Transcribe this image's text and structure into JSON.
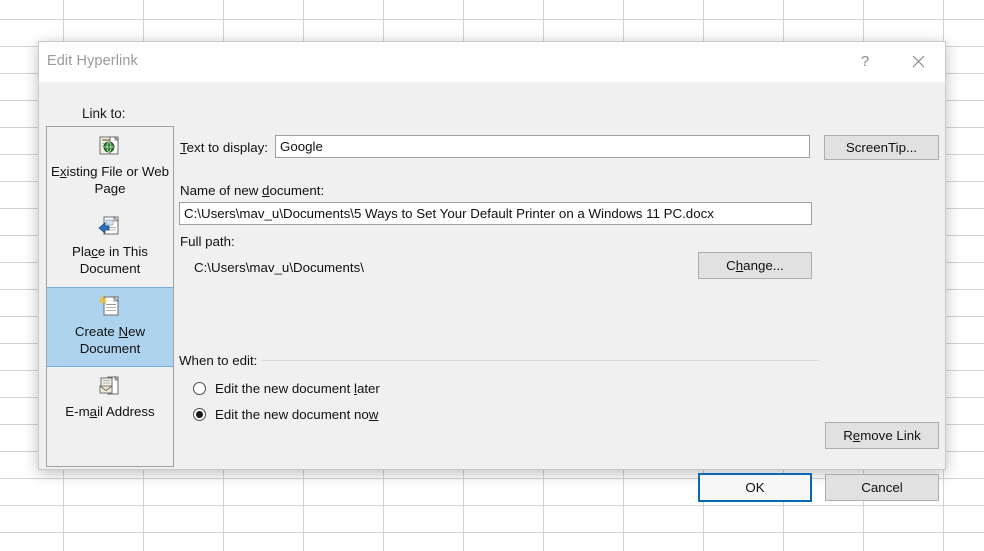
{
  "background": {
    "name": "spreadsheet-grid"
  },
  "dialog": {
    "title": "Edit Hyperlink",
    "help_icon": "?",
    "close_icon": "close-icon",
    "link_to_label": "Link to:",
    "sidebar": [
      {
        "icon": "existing-file-web-page-icon",
        "label_pre": "E",
        "label_key": "x",
        "label_post": "isting File or Web Page",
        "selected": false
      },
      {
        "icon": "place-in-document-icon",
        "label_pre": "Pla",
        "label_key": "c",
        "label_post": "e in This Document",
        "selected": false
      },
      {
        "icon": "create-new-document-icon",
        "label_pre": "Create ",
        "label_key": "N",
        "label_post": "ew Document",
        "selected": true
      },
      {
        "icon": "email-address-icon",
        "label_pre": "E-m",
        "label_key": "a",
        "label_post": "il Address",
        "selected": false
      }
    ],
    "text_to_display": {
      "label_pre": "",
      "label_key": "T",
      "label_post": "ext to display:",
      "value": "Google"
    },
    "screentip_button": {
      "label_pre": "ScreenTip",
      "label_key": "",
      "label_post": "..."
    },
    "name_of_new_document": {
      "label_pre": "Name of new ",
      "label_key": "d",
      "label_post": "ocument:",
      "value": "C:\\Users\\mav_u\\Documents\\5 Ways to Set Your Default Printer on a Windows 11 PC.docx"
    },
    "full_path": {
      "label": "Full path:",
      "value": "C:\\Users\\mav_u\\Documents\\"
    },
    "change_button": {
      "label_pre": "C",
      "label_key": "h",
      "label_post": "ange..."
    },
    "when_to_edit": {
      "title": "When to edit:",
      "options": [
        {
          "label_pre": "Edit the new document ",
          "label_key": "l",
          "label_post": "ater",
          "checked": false
        },
        {
          "label_pre": "Edit the new document no",
          "label_key": "w",
          "label_post": "",
          "checked": true
        }
      ]
    },
    "remove_link_button": {
      "label_pre": "R",
      "label_key": "e",
      "label_post": "move Link"
    },
    "ok_button": {
      "label": "OK"
    },
    "cancel_button": {
      "label": "Cancel"
    }
  },
  "colors": {
    "dialog_body": "#f0f0f0",
    "titlebar": "#ffffff",
    "selected_item": "#aed3ef",
    "selected_border": "#7aaedb",
    "default_button_border": "#0a67b2",
    "button_face": "#e1e1e1",
    "grid_line": "#d4d4d4"
  }
}
